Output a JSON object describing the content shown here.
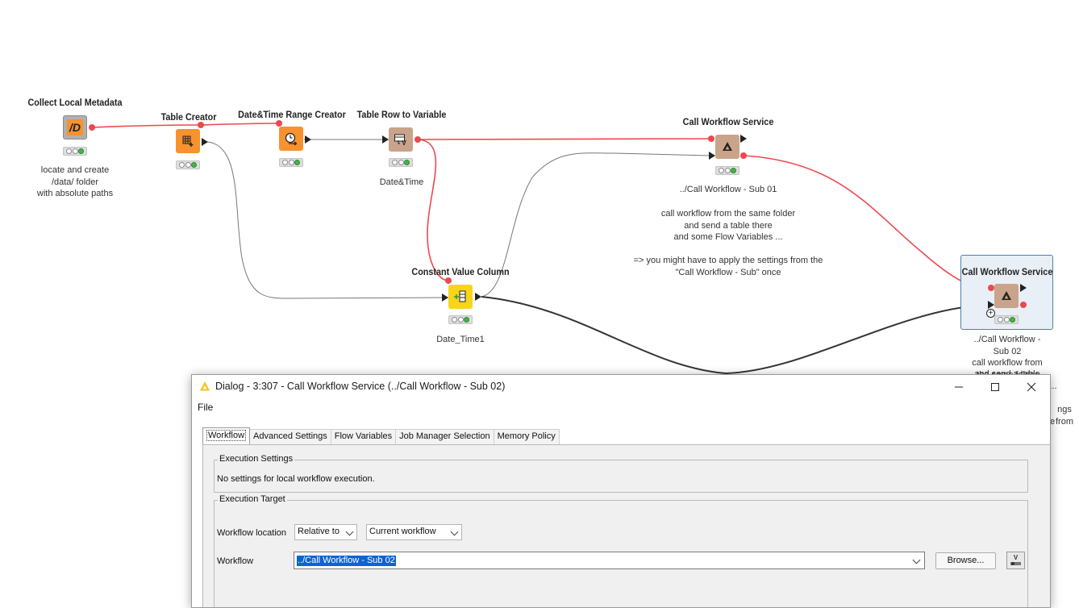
{
  "nodes": {
    "collect_local_metadata": {
      "title": "Collect Local Metadata",
      "label": "locate and create\n/data/ folder\nwith absolute paths",
      "color": "#b0b0b0"
    },
    "table_creator": {
      "title": "Table Creator",
      "color": "#f7922e"
    },
    "datetime_range_creator": {
      "title": "Date&Time Range Creator",
      "color": "#f7922e"
    },
    "table_row_to_variable": {
      "title": "Table Row to Variable",
      "label": "Date&Time",
      "color": "#c9a38a"
    },
    "call_workflow_service_1": {
      "title": "Call Workflow Service",
      "label": "../Call Workflow - Sub 01",
      "color": "#c9a38a"
    },
    "constant_value_column": {
      "title": "Constant Value Column",
      "label": "Date_Time1",
      "color": "#f7d51a"
    },
    "call_workflow_service_2": {
      "title": "Call Workflow Service",
      "label": "../Call Workflow - Sub 02",
      "color": "#c9a38a"
    }
  },
  "annotations": {
    "sub01_note": "call workflow from the same folder\nand send a table there\nand some Flow Variables ...\n\n=> you might have to apply the settings from the\n\"Call Workflow - Sub\" once",
    "sub02_note_line1": "call workflow from the same folder",
    "sub02_note_line2": "and send a table there",
    "sub02_note_line3": "...",
    "sub02_note_fragment_1": "ngs from",
    "sub02_note_fragment_2": "e"
  },
  "dialog": {
    "title": "Dialog - 3:307 - Call Workflow Service (../Call Workflow - Sub 02)",
    "menu_file": "File",
    "tabs": [
      "Workflow",
      "Advanced Settings",
      "Flow Variables",
      "Job Manager Selection",
      "Memory Policy"
    ],
    "execution_settings": {
      "group_title": "Execution Settings",
      "message": "No settings for local workflow execution."
    },
    "execution_target": {
      "group_title": "Execution Target",
      "workflow_location_label": "Workflow location",
      "location_mode": "Relative to",
      "location_base": "Current workflow",
      "workflow_label": "Workflow",
      "workflow_value": "../Call Workflow - Sub 02",
      "browse_label": "Browse..."
    }
  },
  "colors": {
    "variable_connection": "#f0474e",
    "data_connection": "#222222",
    "selection_border": "#4d7fb5"
  }
}
